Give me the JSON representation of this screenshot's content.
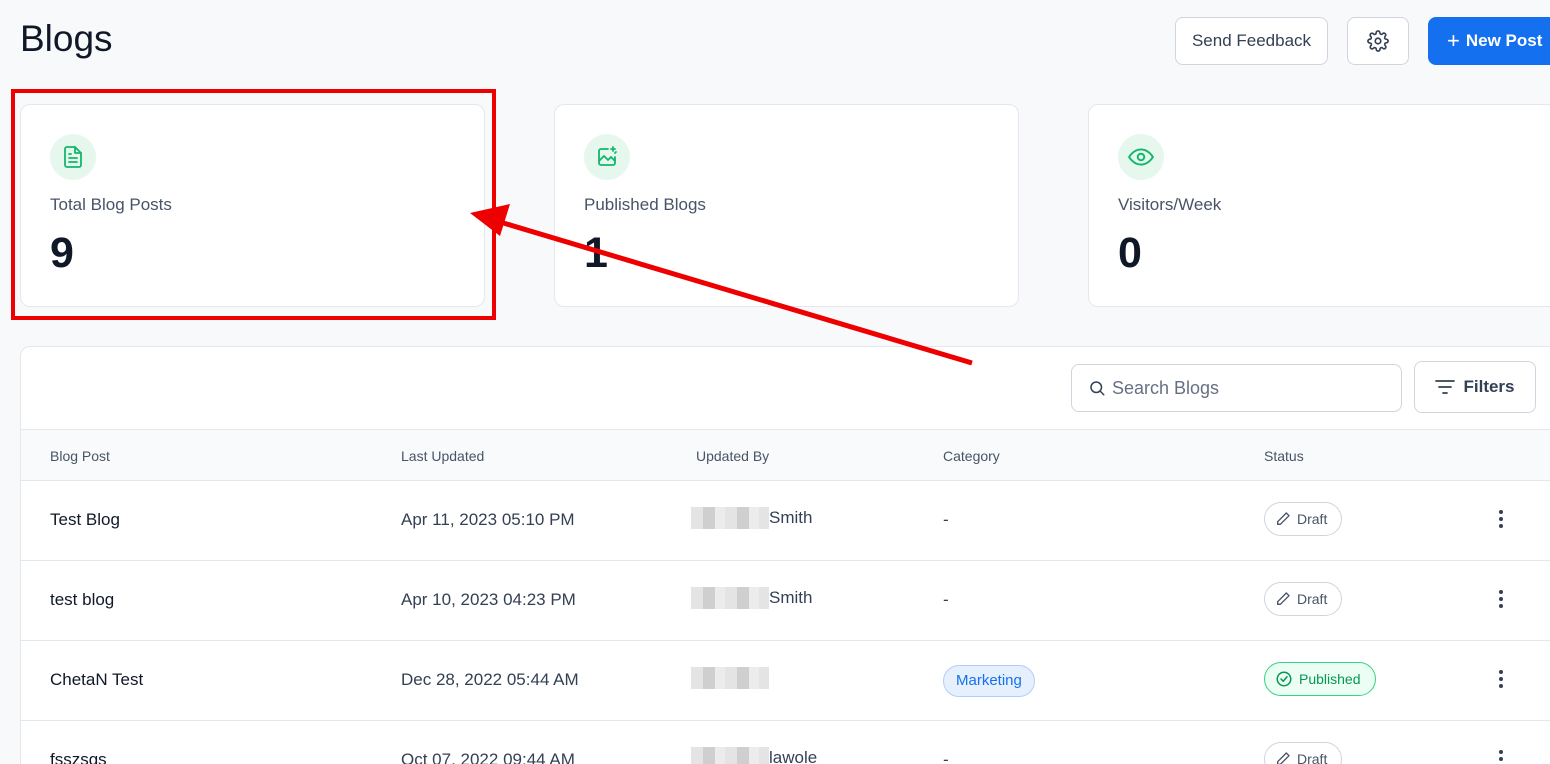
{
  "header": {
    "title": "Blogs",
    "send_feedback": "Send Feedback",
    "new_post": "New Post",
    "settings_icon": "gear-icon"
  },
  "stats": [
    {
      "label": "Total Blog Posts",
      "value": "9",
      "icon": "document-icon"
    },
    {
      "label": "Published Blogs",
      "value": "1",
      "icon": "image-sparkle-icon"
    },
    {
      "label": "Visitors/Week",
      "value": "0",
      "icon": "eye-icon"
    }
  ],
  "colors": {
    "accent": "#1570ef",
    "annotation": "#ee0000",
    "icon_green": "#12b76a",
    "published": "#039855"
  },
  "table": {
    "search_placeholder": "Search Blogs",
    "filters_label": "Filters",
    "columns": [
      "Blog Post",
      "Last Updated",
      "Updated By",
      "Category",
      "Status"
    ],
    "rows": [
      {
        "post": "Test Blog",
        "updated": "Apr 11, 2023 05:10 PM",
        "by": "Smith",
        "category": "-",
        "status": "Draft"
      },
      {
        "post": "test blog",
        "updated": "Apr 10, 2023 04:23 PM",
        "by": "Smith",
        "category": "-",
        "status": "Draft"
      },
      {
        "post": "ChetaN Test",
        "updated": "Dec 28, 2022 05:44 AM",
        "by": "",
        "category": "Marketing",
        "status": "Published"
      },
      {
        "post": "fsszsgs",
        "updated": "Oct 07, 2022 09:44 AM",
        "by": "lawole",
        "category": "-",
        "status": "Draft"
      }
    ]
  }
}
